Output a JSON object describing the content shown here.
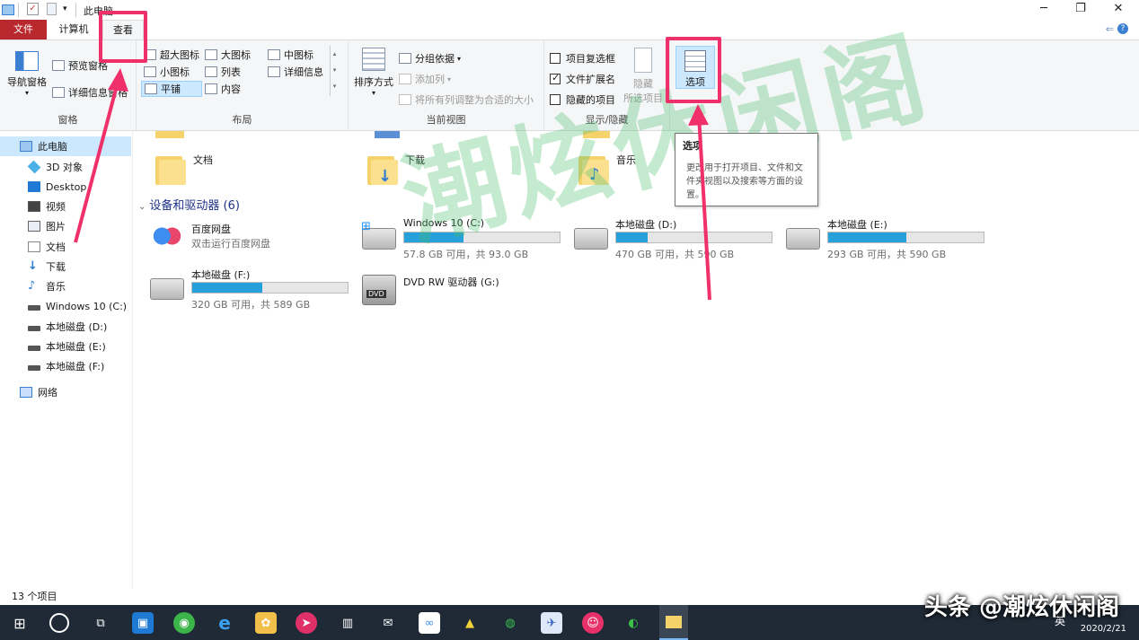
{
  "window": {
    "title": "此电脑",
    "btn_min": "─",
    "btn_max": "❐",
    "btn_close": "✕"
  },
  "tabs": {
    "file": "文件",
    "computer": "计算机",
    "view": "查看"
  },
  "ribbon": {
    "pane": {
      "nav_pane": "导航窗格",
      "preview_pane": "预览窗格",
      "details_pane": "详细信息窗格",
      "label": "窗格"
    },
    "layout": {
      "items": [
        "超大图标",
        "大图标",
        "中图标",
        "小图标",
        "列表",
        "详细信息",
        "平铺",
        "内容"
      ],
      "label": "布局"
    },
    "current_view": {
      "sort_by": "排序方式",
      "group_by": "分组依据",
      "add_columns": "添加列",
      "size_all": "将所有列调整为合适的大小",
      "label": "当前视图"
    },
    "show_hide": {
      "item_checkboxes": "项目复选框",
      "file_extensions": "文件扩展名",
      "hidden_items": "隐藏的项目",
      "hide_selected_1": "隐藏",
      "hide_selected_2": "所选项目",
      "label": "显示/隐藏"
    },
    "options": {
      "label": "选项"
    }
  },
  "nav": {
    "items": [
      {
        "label": "此电脑",
        "icon": "monitor-icon",
        "selected": true
      },
      {
        "label": "3D 对象",
        "icon": "cube-icon"
      },
      {
        "label": "Desktop",
        "icon": "desktop-icon"
      },
      {
        "label": "视频",
        "icon": "video-icon"
      },
      {
        "label": "图片",
        "icon": "picture-icon"
      },
      {
        "label": "文档",
        "icon": "document-icon"
      },
      {
        "label": "下载",
        "icon": "download-icon"
      },
      {
        "label": "音乐",
        "icon": "music-icon"
      },
      {
        "label": "Windows 10 (C:)",
        "icon": "drive-icon"
      },
      {
        "label": "本地磁盘 (D:)",
        "icon": "drive-icon"
      },
      {
        "label": "本地磁盘 (E:)",
        "icon": "drive-icon"
      },
      {
        "label": "本地磁盘 (F:)",
        "icon": "drive-icon"
      },
      {
        "label": "网络",
        "icon": "network-icon"
      }
    ]
  },
  "content": {
    "folders": [
      {
        "name": "文档"
      },
      {
        "name": "下载"
      },
      {
        "name": "音乐"
      }
    ],
    "devices_title": "设备和驱动器 (6)",
    "drives": [
      {
        "name": "百度网盘",
        "sub": "双击运行百度网盘"
      },
      {
        "name": "Windows 10 (C:)",
        "sub": "57.8 GB 可用，共 93.0 GB",
        "used": 0.38
      },
      {
        "name": "本地磁盘 (D:)",
        "sub": "470 GB 可用，共 590 GB",
        "used": 0.2
      },
      {
        "name": "本地磁盘 (E:)",
        "sub": "293 GB 可用，共 590 GB",
        "used": 0.5
      },
      {
        "name": "本地磁盘 (F:)",
        "sub": "320 GB 可用，共 589 GB",
        "used": 0.45
      },
      {
        "name": "DVD RW 驱动器 (G:)"
      }
    ]
  },
  "tooltip": {
    "title": "选项",
    "body": "更改用于打开项目、文件和文件夹视图以及搜索等方面的设置。"
  },
  "status": {
    "count": "13 个项目"
  },
  "taskbar": {
    "lang": "英",
    "date": "2020/2/21"
  },
  "watermark": "潮炫休闲阁",
  "brand": "头条 @潮炫休闲阁",
  "colors": {
    "file_tab": "#b8282c",
    "selection": "#cce8ff",
    "progress": "#26a0da",
    "annotation": "#f0306a",
    "taskbar": "#1f2a36"
  }
}
